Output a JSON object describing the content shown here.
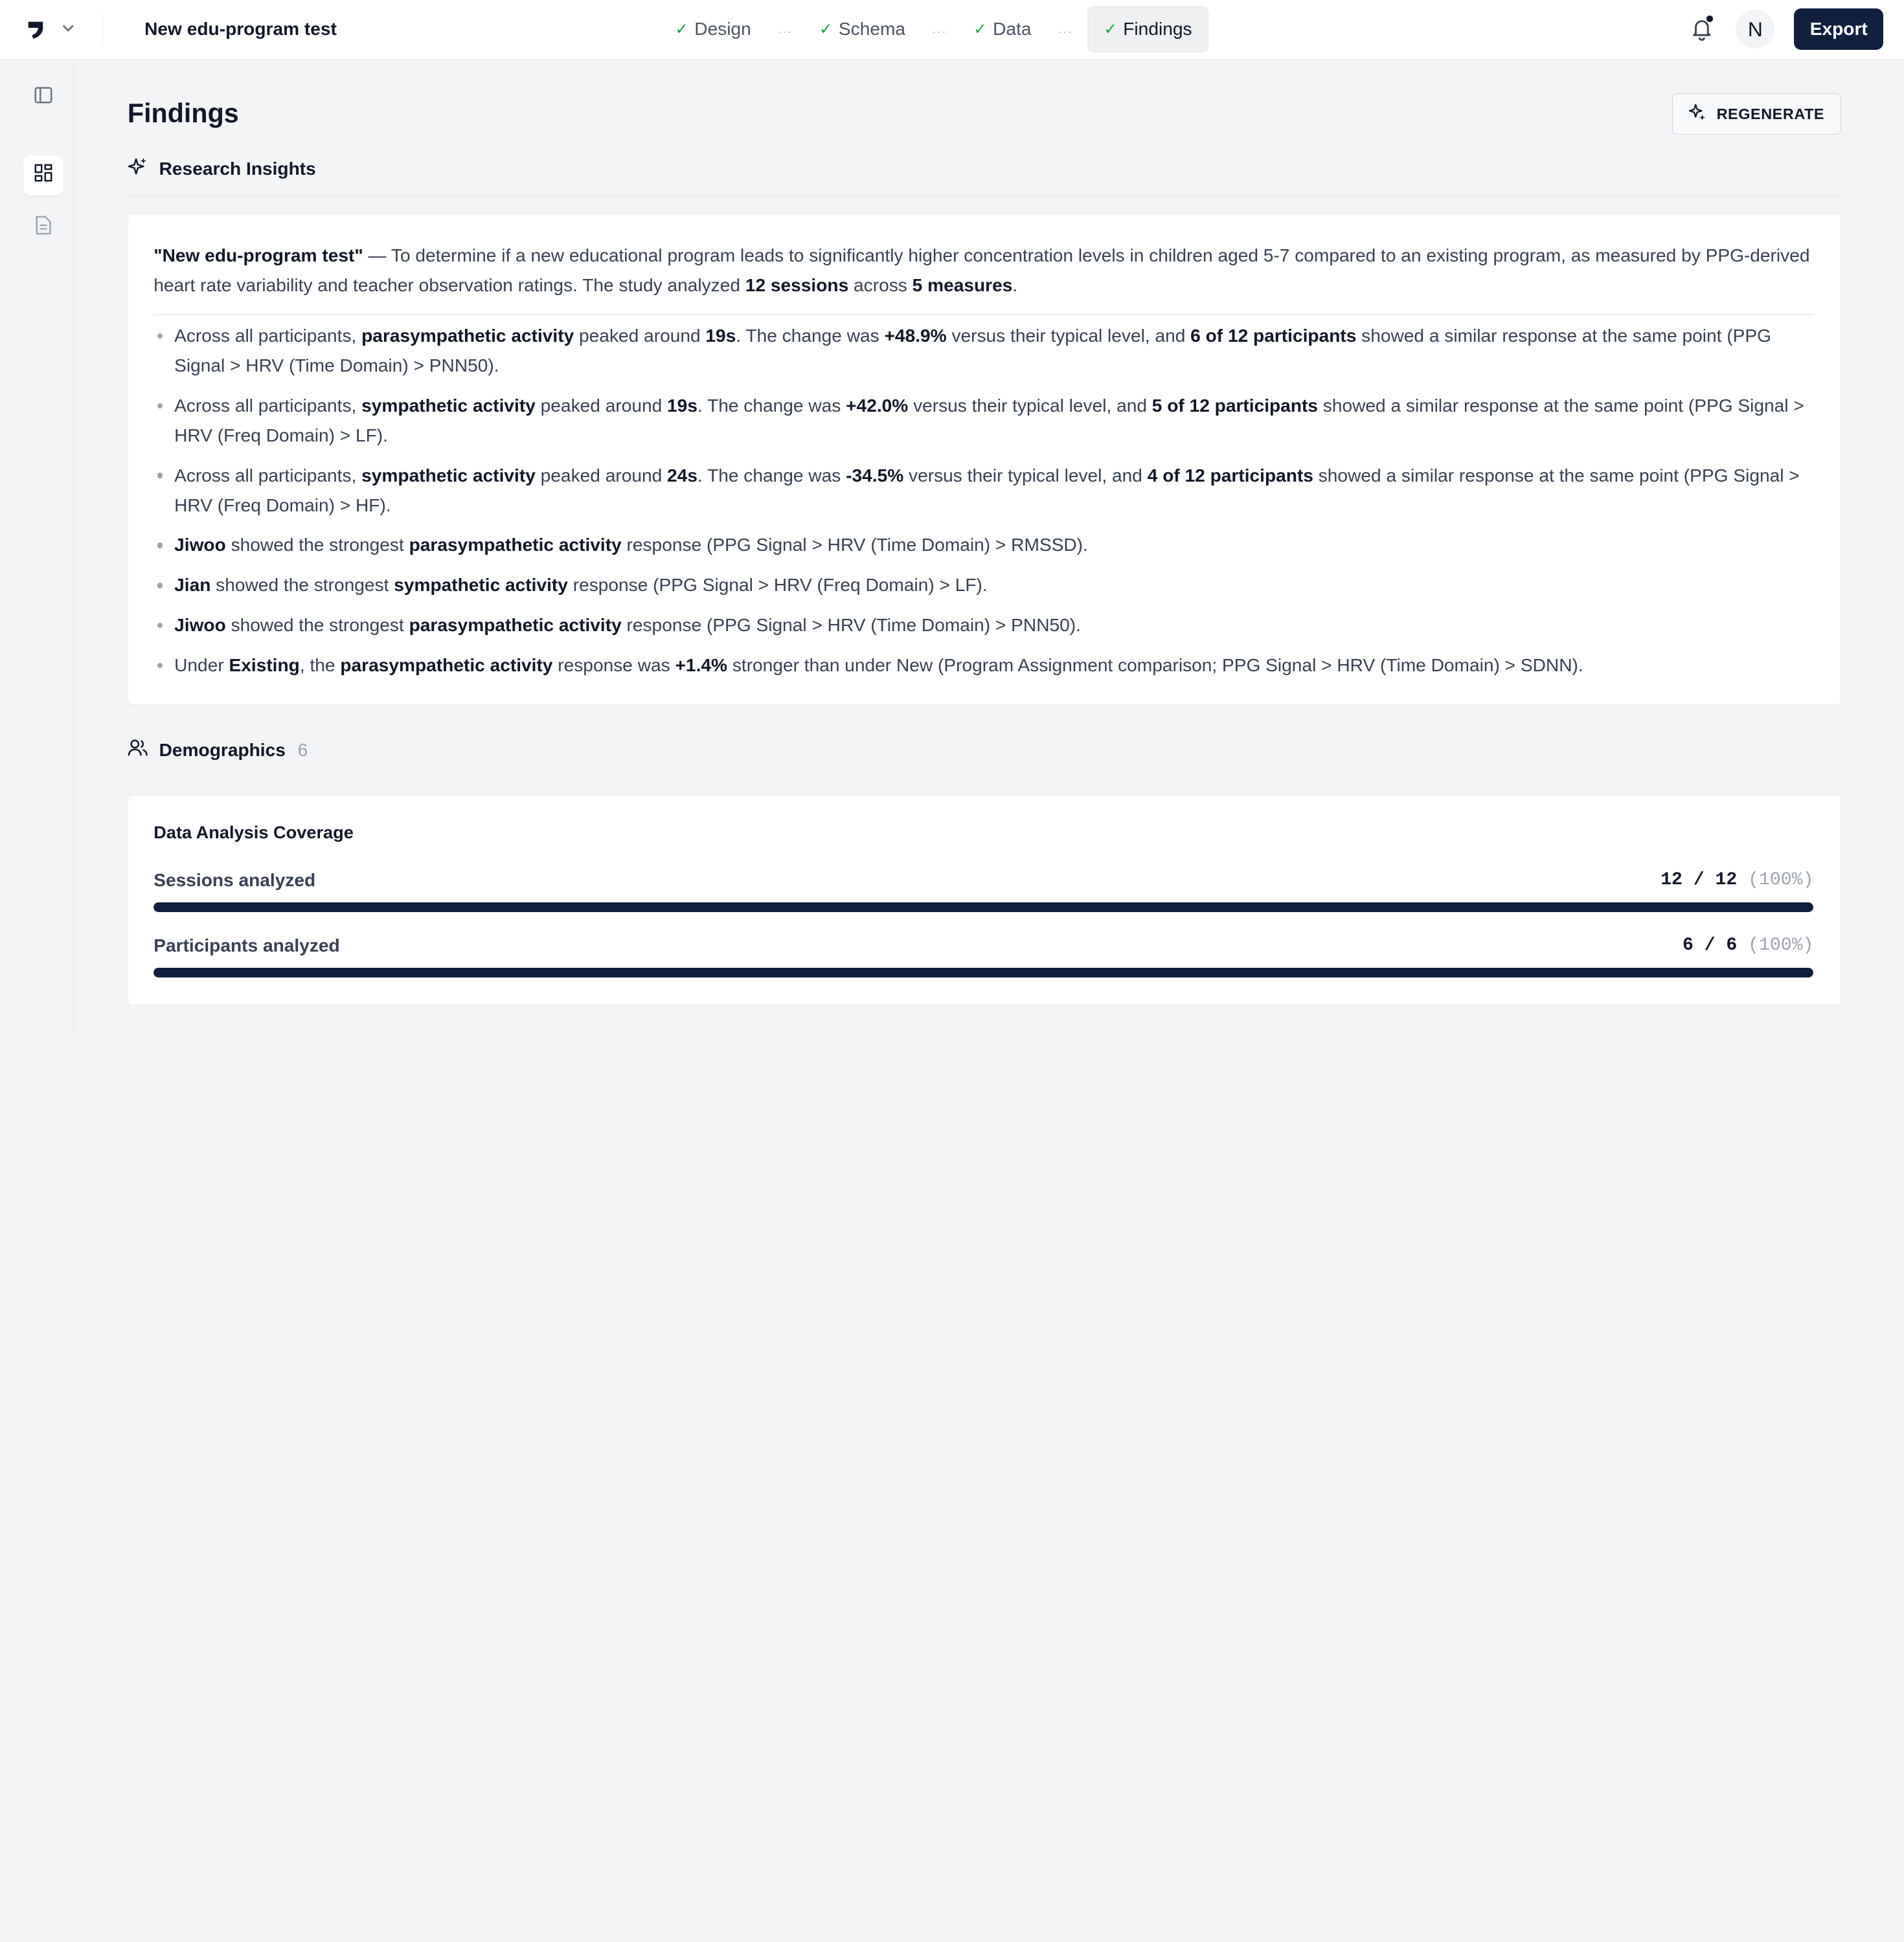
{
  "header": {
    "project_title": "New edu-program test",
    "steps": [
      {
        "label": "Design",
        "done": true,
        "active": false
      },
      {
        "label": "Schema",
        "done": true,
        "active": false
      },
      {
        "label": "Data",
        "done": true,
        "active": false
      },
      {
        "label": "Findings",
        "done": true,
        "active": true
      }
    ],
    "step_separator": "...",
    "avatar_initial": "N",
    "export_label": "Export"
  },
  "rail": {
    "items": [
      {
        "icon": "sidebar-toggle-icon",
        "active": false
      },
      {
        "icon": "dashboard-icon",
        "active": true
      },
      {
        "icon": "document-icon",
        "active": false
      }
    ]
  },
  "findings": {
    "title": "Findings",
    "regenerate_label": "REGENERATE",
    "insights_heading": "Research Insights",
    "summary": [
      {
        "t": "\"New edu-program test\"",
        "b": true
      },
      {
        "t": " — To determine if a new educational program leads to significantly higher concentration levels in children aged 5-7 compared to an existing program, as measured by PPG-derived heart rate variability and teacher observation ratings. The study analyzed ",
        "b": false
      },
      {
        "t": "12 sessions",
        "b": true
      },
      {
        "t": " across ",
        "b": false
      },
      {
        "t": "5 measures",
        "b": true
      },
      {
        "t": ".",
        "b": false
      }
    ],
    "insights": [
      [
        {
          "t": "Across all participants, ",
          "b": false
        },
        {
          "t": "parasympathetic activity",
          "b": true
        },
        {
          "t": " peaked around ",
          "b": false
        },
        {
          "t": "19s",
          "b": true
        },
        {
          "t": ". The change was ",
          "b": false
        },
        {
          "t": "+48.9%",
          "b": true
        },
        {
          "t": " versus their typical level, and ",
          "b": false
        },
        {
          "t": "6 of 12 participants",
          "b": true
        },
        {
          "t": " showed a similar response at the same point (PPG Signal > HRV (Time Domain) > PNN50).",
          "b": false
        }
      ],
      [
        {
          "t": "Across all participants, ",
          "b": false
        },
        {
          "t": "sympathetic activity",
          "b": true
        },
        {
          "t": " peaked around ",
          "b": false
        },
        {
          "t": "19s",
          "b": true
        },
        {
          "t": ". The change was ",
          "b": false
        },
        {
          "t": "+42.0%",
          "b": true
        },
        {
          "t": " versus their typical level, and ",
          "b": false
        },
        {
          "t": "5 of 12 participants",
          "b": true
        },
        {
          "t": " showed a similar response at the same point (PPG Signal > HRV (Freq Domain) > LF).",
          "b": false
        }
      ],
      [
        {
          "t": "Across all participants, ",
          "b": false
        },
        {
          "t": "sympathetic activity",
          "b": true
        },
        {
          "t": " peaked around ",
          "b": false
        },
        {
          "t": "24s",
          "b": true
        },
        {
          "t": ". The change was ",
          "b": false
        },
        {
          "t": "-34.5%",
          "b": true
        },
        {
          "t": " versus their typical level, and ",
          "b": false
        },
        {
          "t": "4 of 12 participants",
          "b": true
        },
        {
          "t": " showed a similar response at the same point (PPG Signal > HRV (Freq Domain) > HF).",
          "b": false
        }
      ],
      [
        {
          "t": "Jiwoo",
          "b": true
        },
        {
          "t": " showed the strongest ",
          "b": false
        },
        {
          "t": "parasympathetic activity",
          "b": true
        },
        {
          "t": " response (PPG Signal > HRV (Time Domain) > RMSSD).",
          "b": false
        }
      ],
      [
        {
          "t": "Jian",
          "b": true
        },
        {
          "t": " showed the strongest ",
          "b": false
        },
        {
          "t": "sympathetic activity",
          "b": true
        },
        {
          "t": " response (PPG Signal > HRV (Freq Domain) > LF).",
          "b": false
        }
      ],
      [
        {
          "t": "Jiwoo",
          "b": true
        },
        {
          "t": " showed the strongest ",
          "b": false
        },
        {
          "t": "parasympathetic activity",
          "b": true
        },
        {
          "t": " response (PPG Signal > HRV (Time Domain) > PNN50).",
          "b": false
        }
      ],
      [
        {
          "t": "Under ",
          "b": false
        },
        {
          "t": "Existing",
          "b": true
        },
        {
          "t": ", the ",
          "b": false
        },
        {
          "t": "parasympathetic activity",
          "b": true
        },
        {
          "t": " response was ",
          "b": false
        },
        {
          "t": "+1.4%",
          "b": true
        },
        {
          "t": " stronger than under New (Program Assignment comparison; PPG Signal > HRV (Time Domain) > SDNN).",
          "b": false
        }
      ]
    ],
    "demographics_heading": "Demographics",
    "demographics_count": "6",
    "coverage": {
      "title": "Data Analysis Coverage",
      "rows": [
        {
          "label": "Sessions analyzed",
          "value": "12 / 12",
          "pct_label": "(100%)",
          "fraction": 1.0
        },
        {
          "label": "Participants analyzed",
          "value": "6 / 6",
          "pct_label": "(100%)",
          "fraction": 1.0
        }
      ]
    }
  },
  "colors": {
    "accent_navy": "#0f1f3d",
    "check_green": "#16a34a",
    "page_bg": "#f3f4f6"
  }
}
